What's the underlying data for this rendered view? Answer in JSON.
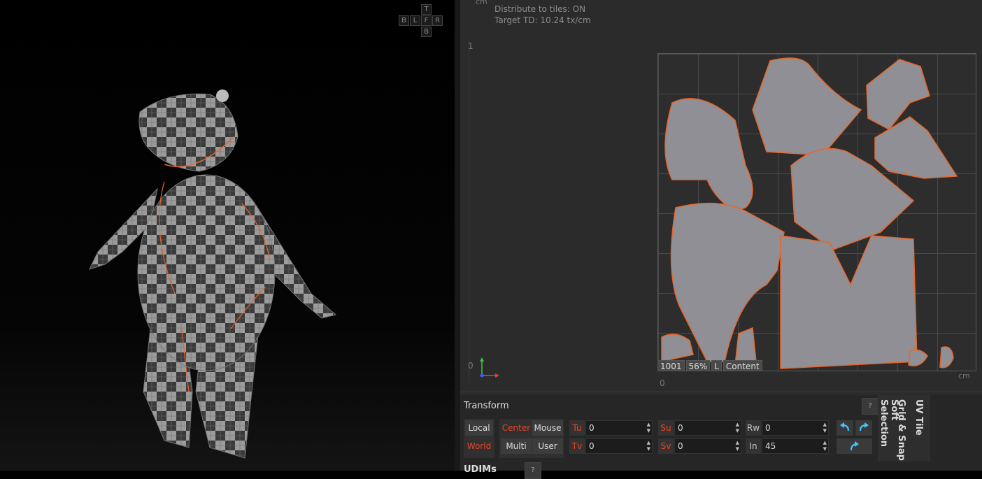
{
  "viewport": {
    "nav_cube": {
      "top": "T",
      "back": "B",
      "left": "L",
      "front": "F",
      "right": "R",
      "bottom": "B"
    }
  },
  "uv_editor": {
    "unit_top": "cm",
    "distribute_to_tiles": "Distribute to tiles: ON",
    "target_td": "Target TD: 10.24 tx/cm",
    "v_axis_1": "1",
    "v_axis_0": "0",
    "u_axis_0": "0",
    "unit_bottom": "cm",
    "tile": {
      "id": "1001",
      "percent": "56%",
      "mode": "L",
      "content": "Content"
    },
    "colors": {
      "seam": "#e8662a",
      "island_fill": "#8f8f95",
      "grid": "#4a4a4a"
    }
  },
  "transform": {
    "title": "Transform",
    "help": "?",
    "space": {
      "local": "Local",
      "world": "World"
    },
    "pivot": {
      "center": "Center",
      "mouse": "Mouse",
      "multi": "Multi",
      "user": "User"
    },
    "tu_label": "Tu",
    "tu_value": "0",
    "tv_label": "Tv",
    "tv_value": "0",
    "su_label": "Su",
    "su_value": "0",
    "sv_label": "Sv",
    "sv_value": "0",
    "rw_label": "Rw",
    "rw_value": "0",
    "in_label": "In",
    "in_value": "45",
    "icons": {
      "undo": "rotate-ccw-icon",
      "redo": "rotate-cw-icon",
      "flip": "flip-arrow-icon"
    },
    "accent": "#ee4422"
  },
  "side_tabs": {
    "soft_selection": "Soft Selection",
    "grid_snap": "Grid & Snap",
    "uv_tile": "UV Tile"
  },
  "udims": {
    "title": "UDIMs",
    "help": "?"
  }
}
